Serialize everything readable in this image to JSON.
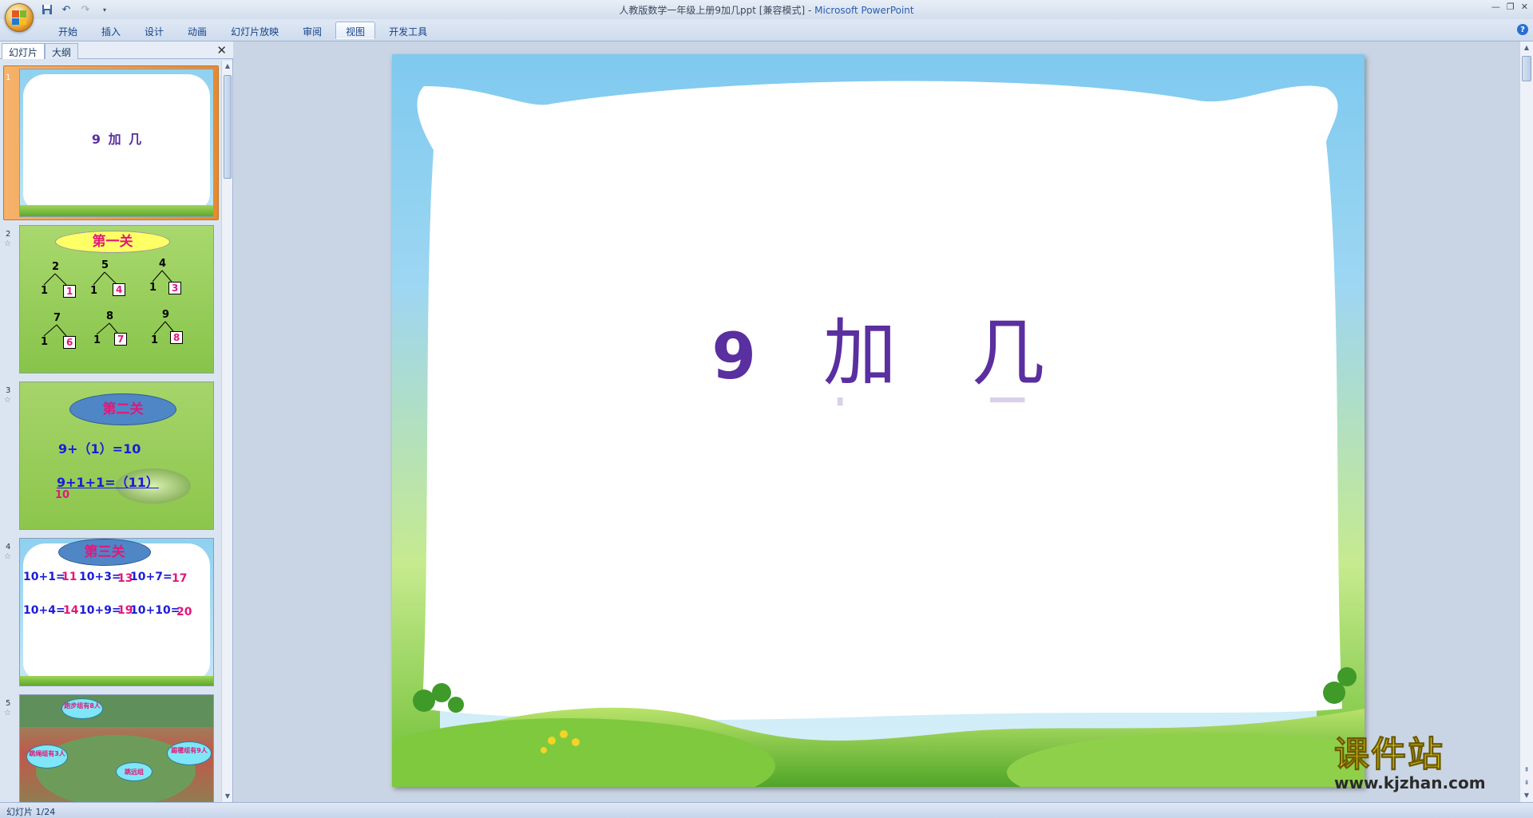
{
  "window": {
    "title_doc": "人教版数学一年级上册9加几ppt [兼容模式]",
    "title_sep": " - ",
    "title_app": "Microsoft PowerPoint"
  },
  "ribbon": {
    "tabs": [
      "开始",
      "插入",
      "设计",
      "动画",
      "幻灯片放映",
      "审阅",
      "视图",
      "开发工具"
    ],
    "active_tab": "视图"
  },
  "left_pane": {
    "tab_slides": "幻灯片",
    "tab_outline": "大纲",
    "thumbnails": [
      {
        "num": "1",
        "title": "9 加 几"
      },
      {
        "num": "2",
        "title": "第一关",
        "trees": [
          {
            "top": "2",
            "left": "1",
            "box": "1"
          },
          {
            "top": "5",
            "left": "1",
            "box": "4"
          },
          {
            "top": "4",
            "left": "1",
            "box": "3"
          },
          {
            "top": "7",
            "left": "1",
            "box": "6"
          },
          {
            "top": "8",
            "left": "1",
            "box": "7"
          },
          {
            "top": "9",
            "left": "1",
            "box": "8"
          }
        ]
      },
      {
        "num": "3",
        "title": "第二关",
        "line1": "9+（1）=10",
        "line2": "9+1+1=（11）",
        "sub": "10"
      },
      {
        "num": "4",
        "title": "第三关",
        "eqs": [
          {
            "q": "10+1=",
            "a": "11"
          },
          {
            "q": "10+3=",
            "a": "13"
          },
          {
            "q": "10+7=",
            "a": "17"
          },
          {
            "q": "10+4=",
            "a": "14"
          },
          {
            "q": "10+9=",
            "a": "19"
          },
          {
            "q": "10+10=",
            "a": "20"
          }
        ]
      },
      {
        "num": "5",
        "bubbles": [
          "跑步组有8人",
          "跳绳组有3人",
          "踢毽组有9人",
          "跳远组"
        ]
      }
    ]
  },
  "slide": {
    "title_num": "9",
    "title_word1": "加",
    "title_word2": "几"
  },
  "watermark": {
    "cn": "课件站",
    "url": "www.kjzhan.com"
  },
  "statusbar": {
    "slide_info": "幻灯片 1/24"
  },
  "colors": {
    "title_purple": "#5a2fa0",
    "accent_orange": "#e9892d",
    "ribbon_text": "#15428b"
  }
}
